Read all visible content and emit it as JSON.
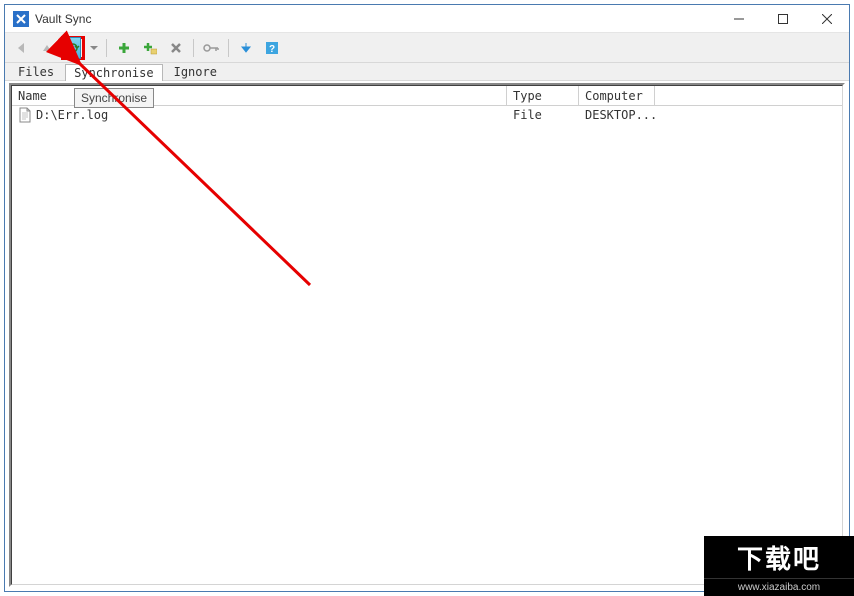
{
  "window": {
    "title": "Vault Sync"
  },
  "toolbar": {
    "icons": {
      "back": "back-arrow",
      "forward": "forward-arrow",
      "sync": "sync",
      "dropdown": "dropdown",
      "add": "add",
      "add_sub": "add-sub",
      "delete": "delete",
      "key": "key",
      "download": "download",
      "help": "help"
    }
  },
  "tabs": {
    "items": [
      {
        "label": "Files",
        "active": false
      },
      {
        "label": "Synchronise",
        "active": true
      },
      {
        "label": "Ignore",
        "active": false
      }
    ]
  },
  "table": {
    "columns": {
      "name": "Name",
      "type": "Type",
      "computer": "Computer"
    },
    "rows": [
      {
        "name": "D:\\Err.log",
        "type": "File",
        "computer": "DESKTOP..."
      }
    ]
  },
  "tooltip": {
    "text": "Synchronise"
  },
  "watermark": {
    "logo": "下载吧",
    "url": "www.xiazaiba.com"
  }
}
